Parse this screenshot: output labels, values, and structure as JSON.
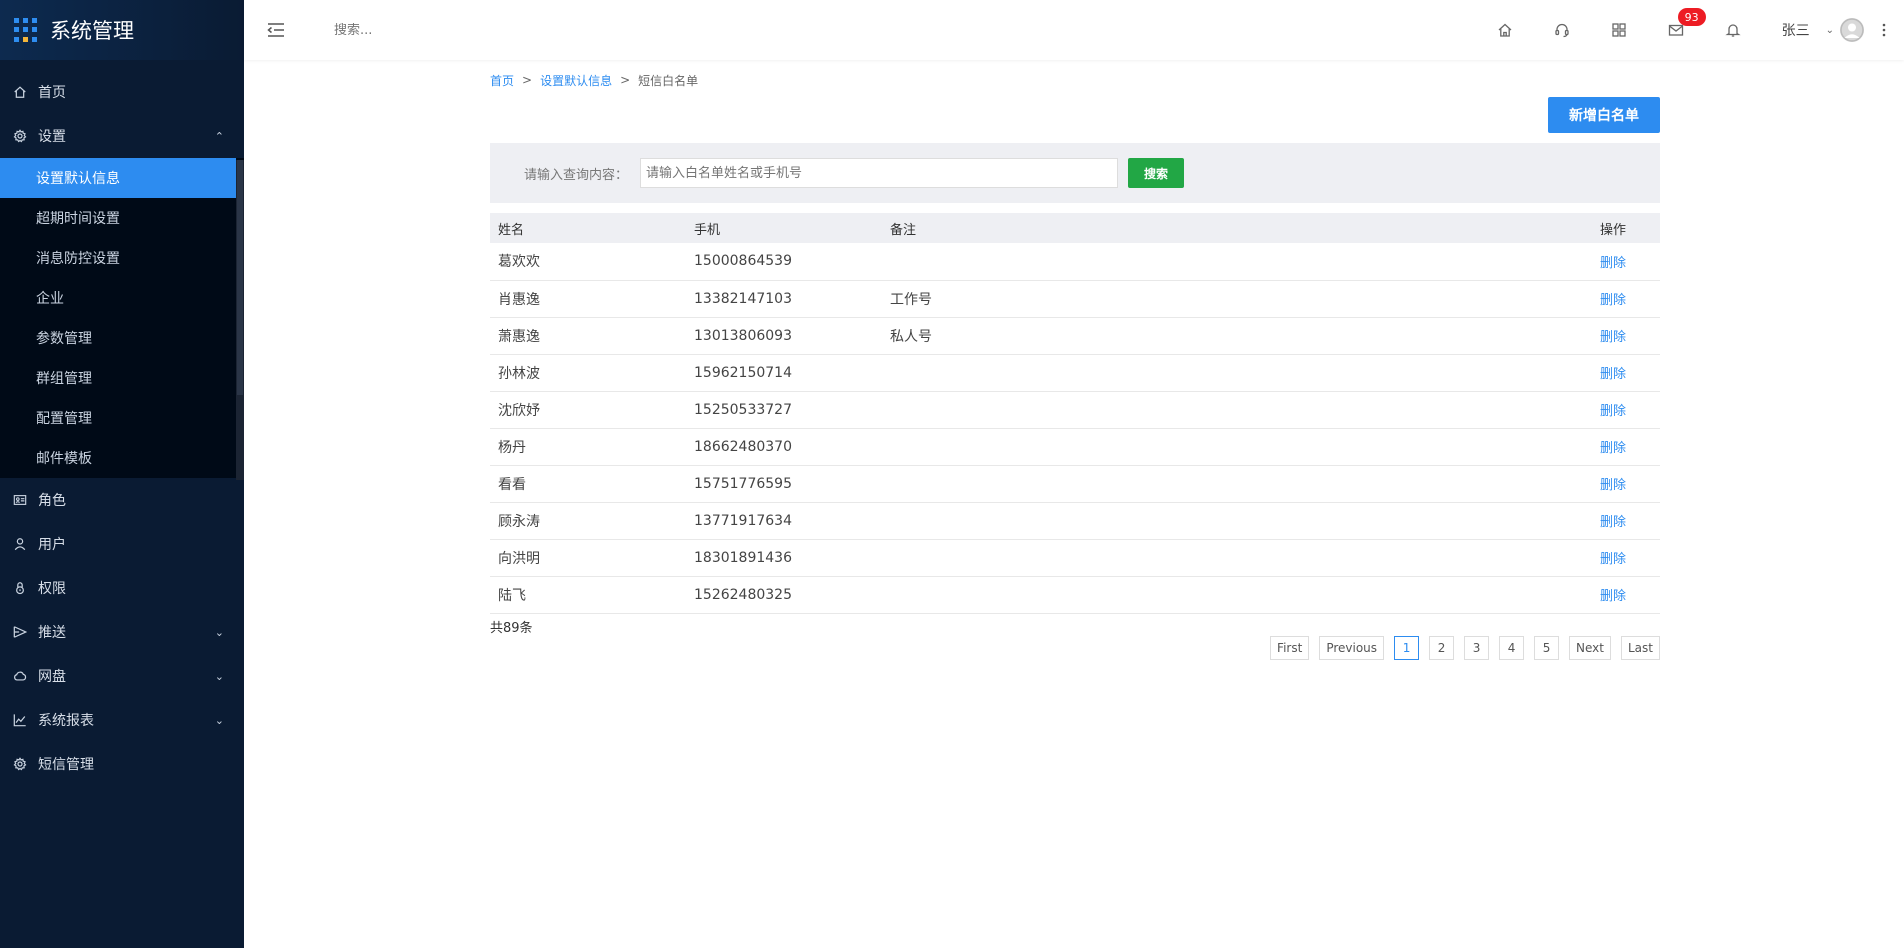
{
  "app": {
    "title": "系统管理"
  },
  "sidebar": {
    "items": [
      {
        "label": "首页",
        "icon": "home-icon"
      },
      {
        "label": "设置",
        "icon": "gear-icon",
        "expanded": true
      },
      {
        "label": "角色",
        "icon": "id-card-icon"
      },
      {
        "label": "用户",
        "icon": "user-icon"
      },
      {
        "label": "权限",
        "icon": "lock-icon"
      },
      {
        "label": "推送",
        "icon": "send-icon"
      },
      {
        "label": "网盘",
        "icon": "cloud-icon"
      },
      {
        "label": "系统报表",
        "icon": "chart-icon"
      },
      {
        "label": "短信管理",
        "icon": "gear-icon"
      }
    ],
    "settings_submenu": [
      {
        "label": "设置默认信息",
        "active": true
      },
      {
        "label": "超期时间设置"
      },
      {
        "label": "消息防控设置"
      },
      {
        "label": "企业"
      },
      {
        "label": "参数管理"
      },
      {
        "label": "群组管理"
      },
      {
        "label": "配置管理"
      },
      {
        "label": "邮件模板"
      }
    ]
  },
  "topbar": {
    "search_placeholder": "搜索...",
    "mail_badge": "93",
    "user_name": "张三"
  },
  "breadcrumb": {
    "home": "首页",
    "parent": "设置默认信息",
    "separator": ">",
    "current": "短信白名单"
  },
  "actions": {
    "add_label": "新增白名单"
  },
  "search": {
    "label": "请输入查询内容：",
    "placeholder": "请输入白名单姓名或手机号",
    "button_label": "搜索"
  },
  "table": {
    "headers": {
      "name": "姓名",
      "phone": "手机",
      "note": "备注",
      "op": "操作"
    },
    "rows": [
      {
        "name": "葛欢欢",
        "phone": "15000864539",
        "note": "",
        "op": "删除"
      },
      {
        "name": "肖惠逸",
        "phone": "13382147103",
        "note": "工作号",
        "op": "删除"
      },
      {
        "name": "萧惠逸",
        "phone": "13013806093",
        "note": "私人号",
        "op": "删除"
      },
      {
        "name": "孙林波",
        "phone": "15962150714",
        "note": "",
        "op": "删除"
      },
      {
        "name": "沈欣妤",
        "phone": "15250533727",
        "note": "",
        "op": "删除"
      },
      {
        "name": "杨丹",
        "phone": "18662480370",
        "note": "",
        "op": "删除"
      },
      {
        "name": "看看",
        "phone": "15751776595",
        "note": "",
        "op": "删除"
      },
      {
        "name": "顾永涛",
        "phone": "13771917634",
        "note": "",
        "op": "删除"
      },
      {
        "name": "向洪明",
        "phone": "18301891436",
        "note": "",
        "op": "删除"
      },
      {
        "name": "陆飞",
        "phone": "15262480325",
        "note": "",
        "op": "删除"
      }
    ]
  },
  "pagination": {
    "total": "共89条",
    "first": "First",
    "previous": "Previous",
    "pages": [
      "1",
      "2",
      "3",
      "4",
      "5"
    ],
    "current_page": "1",
    "next": "Next",
    "last": "Last"
  },
  "colors": {
    "sidebar_bg": "#0a1b33",
    "accent": "#2d8cf0",
    "search_button": "#22a745",
    "badge": "#ed1c24"
  }
}
